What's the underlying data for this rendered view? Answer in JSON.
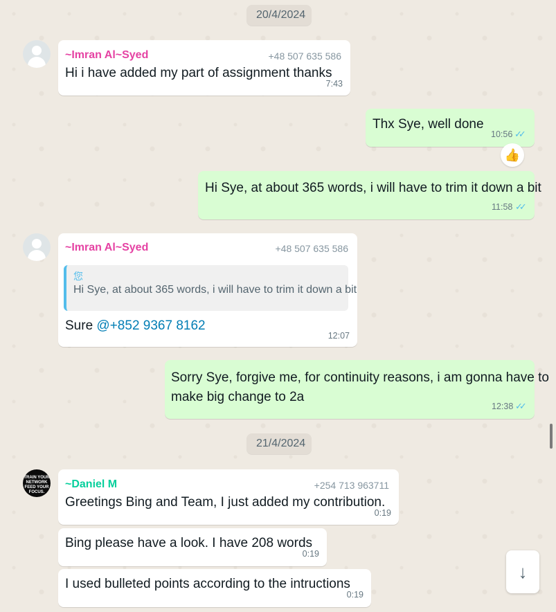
{
  "colors": {
    "background": "#efeae2",
    "incoming_bubble": "#ffffff",
    "outgoing_bubble": "#d9fdd3",
    "imran_name": "#e542a3",
    "daniel_name": "#06cf9c",
    "read_ticks": "#53bdeb",
    "mention": "#027eb5"
  },
  "dates": [
    "20/4/2024",
    "21/4/2024"
  ],
  "messages": [
    {
      "sender": "~Imran Al~Syed",
      "phone": "+48 507 635 586",
      "text": "Hi i have added my part of assignment thanks",
      "time": "7:43"
    },
    {
      "text": "Thx Sye, well done",
      "time": "10:56",
      "ticks": "✓✓",
      "reaction": "👍"
    },
    {
      "text": "Hi Sye, at about 365 words, i will have to trim it down a bit",
      "time": "11:58",
      "ticks": "✓✓"
    },
    {
      "sender": "~Imran Al~Syed",
      "phone": "+48 507 635 586",
      "quote_author": "您",
      "quote_text": "Hi Sye, at about 365 words, i will have to trim it down a bit",
      "text_prefix": "Sure ",
      "mention": "@+852 9367 8162",
      "time": "12:07"
    },
    {
      "text_line1": "Sorry Sye, forgive me, for continuity reasons, i am gonna have to",
      "text_line2": "make big change to 2a",
      "time": "12:38",
      "ticks": "✓✓"
    },
    {
      "sender": "~Daniel M",
      "phone": "+254 713 963711",
      "text": "Greetings Bing and Team, I just added my contribution.",
      "time": "0:19",
      "avatar_text": "TRAIN YOUR NETWORK FEED YOUR FOCUS."
    },
    {
      "text": "Bing please have a look. I have 208 words",
      "time": "0:19"
    },
    {
      "text": "I used bulleted points according to the intructions",
      "time": "0:19"
    }
  ],
  "scroll_button_icon": "arrow-down-icon",
  "scroll_button_glyph": "↓"
}
